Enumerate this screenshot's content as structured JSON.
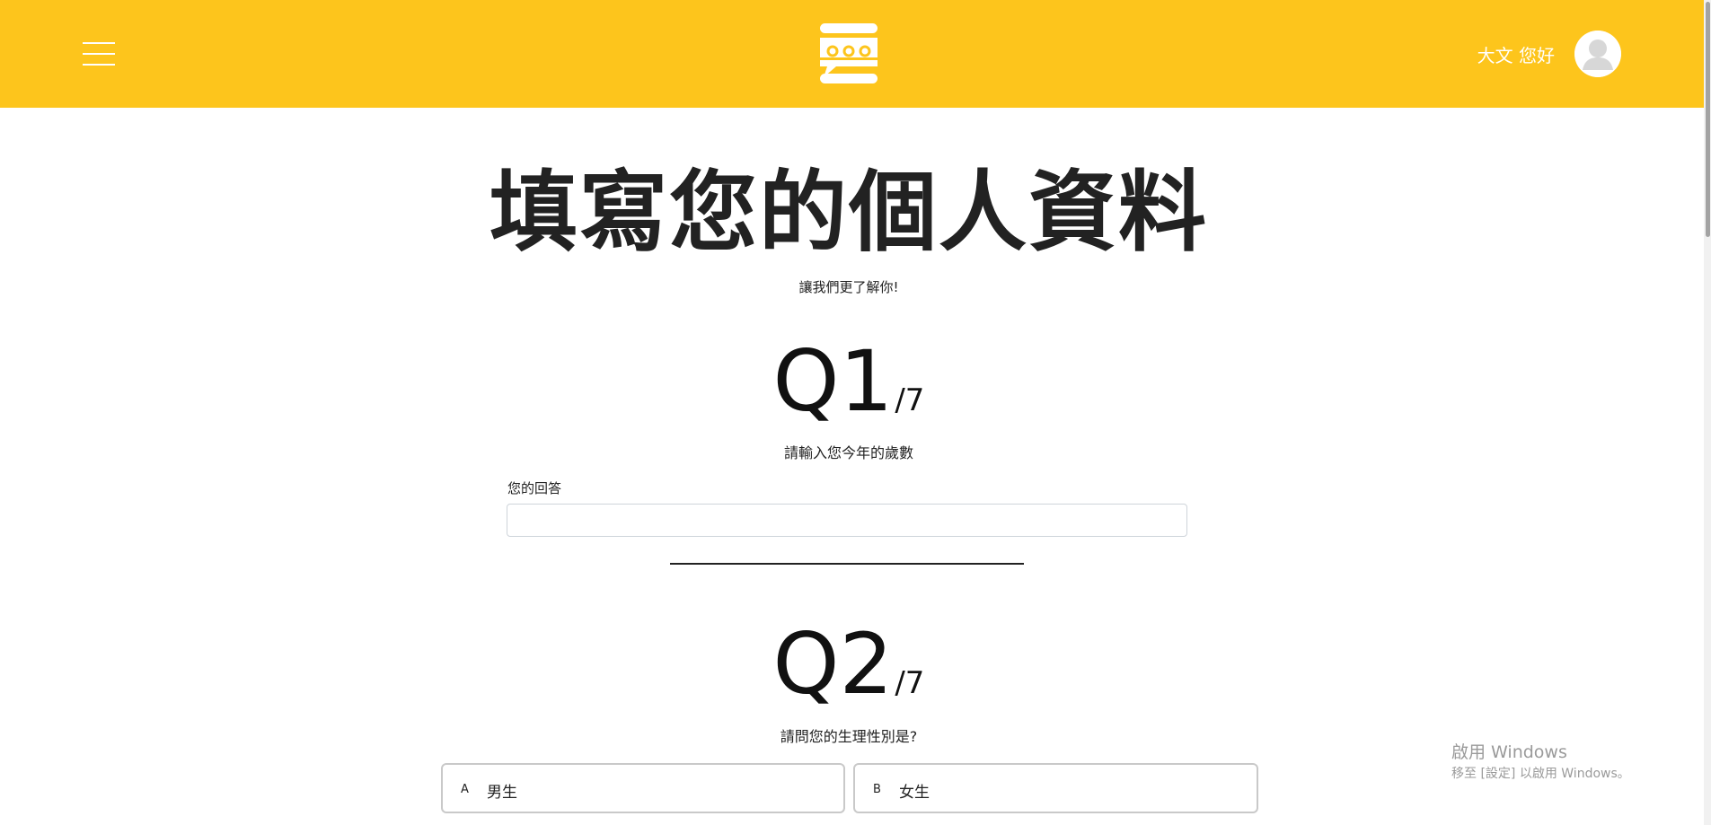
{
  "header": {
    "greeting": "大文 您好",
    "logo_icon": "chat-bubble-logo-icon",
    "menu_icon": "hamburger-menu-icon",
    "avatar_icon": "user-avatar-icon",
    "background_color": "#fdc51c"
  },
  "page": {
    "title": "填寫您的個人資料",
    "subtitle": "讓我們更了解你!"
  },
  "questions": [
    {
      "number": "Q1",
      "total": "/7",
      "prompt": "請輸入您今年的歲數",
      "answer_label": "您的回答",
      "answer_value": ""
    },
    {
      "number": "Q2",
      "total": "/7",
      "prompt": "請問您的生理性別是?",
      "options": [
        {
          "letter": "A",
          "text": "男生"
        },
        {
          "letter": "B",
          "text": "女生"
        }
      ]
    }
  ],
  "os_watermark": {
    "title": "啟用 Windows",
    "subtitle": "移至 [設定] 以啟用 Windows。"
  }
}
